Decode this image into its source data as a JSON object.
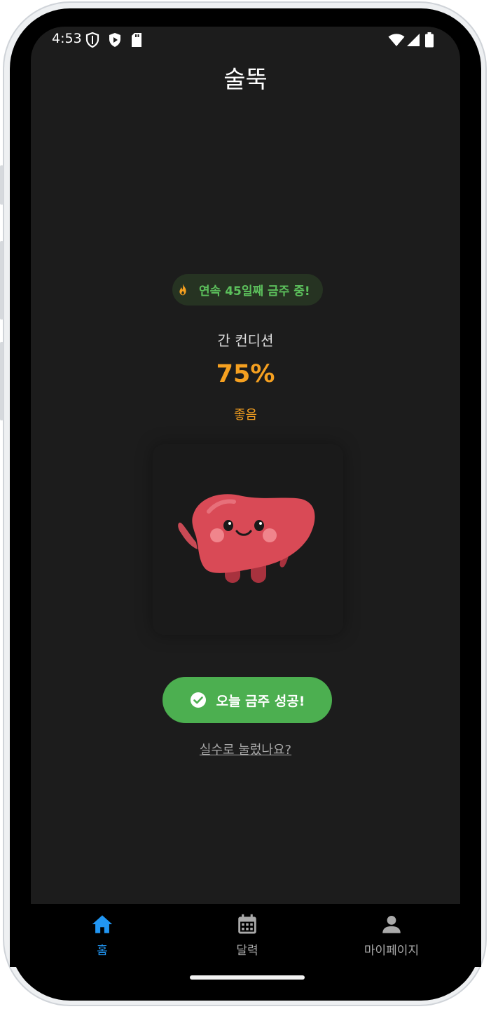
{
  "status_bar": {
    "time": "4:53",
    "left_icons": [
      "vpn-shield-icon",
      "play-protect-icon",
      "sd-card-icon"
    ],
    "right_icons": [
      "wifi-icon",
      "cellular-signal-icon",
      "battery-icon"
    ]
  },
  "header": {
    "title": "술뚝"
  },
  "streak": {
    "icon": "flame-icon",
    "text": "연속 45일째 금주 중!",
    "color": "#5cc05c"
  },
  "liver_condition": {
    "label": "간 컨디션",
    "percent": "75%",
    "status": "좋음",
    "accent_color": "#f5a020"
  },
  "mascot": {
    "icon": "liver-mascot-icon"
  },
  "actions": {
    "success_label": "오늘 금주 성공!",
    "success_icon": "check-circle-icon",
    "success_color": "#4caf50",
    "mistake_link": "실수로 눌렀나요?"
  },
  "bottom_nav": {
    "items": [
      {
        "label": "홈",
        "icon": "home-icon",
        "active": true
      },
      {
        "label": "달력",
        "icon": "calendar-icon",
        "active": false
      },
      {
        "label": "마이페이지",
        "icon": "person-icon",
        "active": false
      }
    ],
    "active_color": "#2196f3",
    "inactive_color": "#aaaaaa"
  }
}
